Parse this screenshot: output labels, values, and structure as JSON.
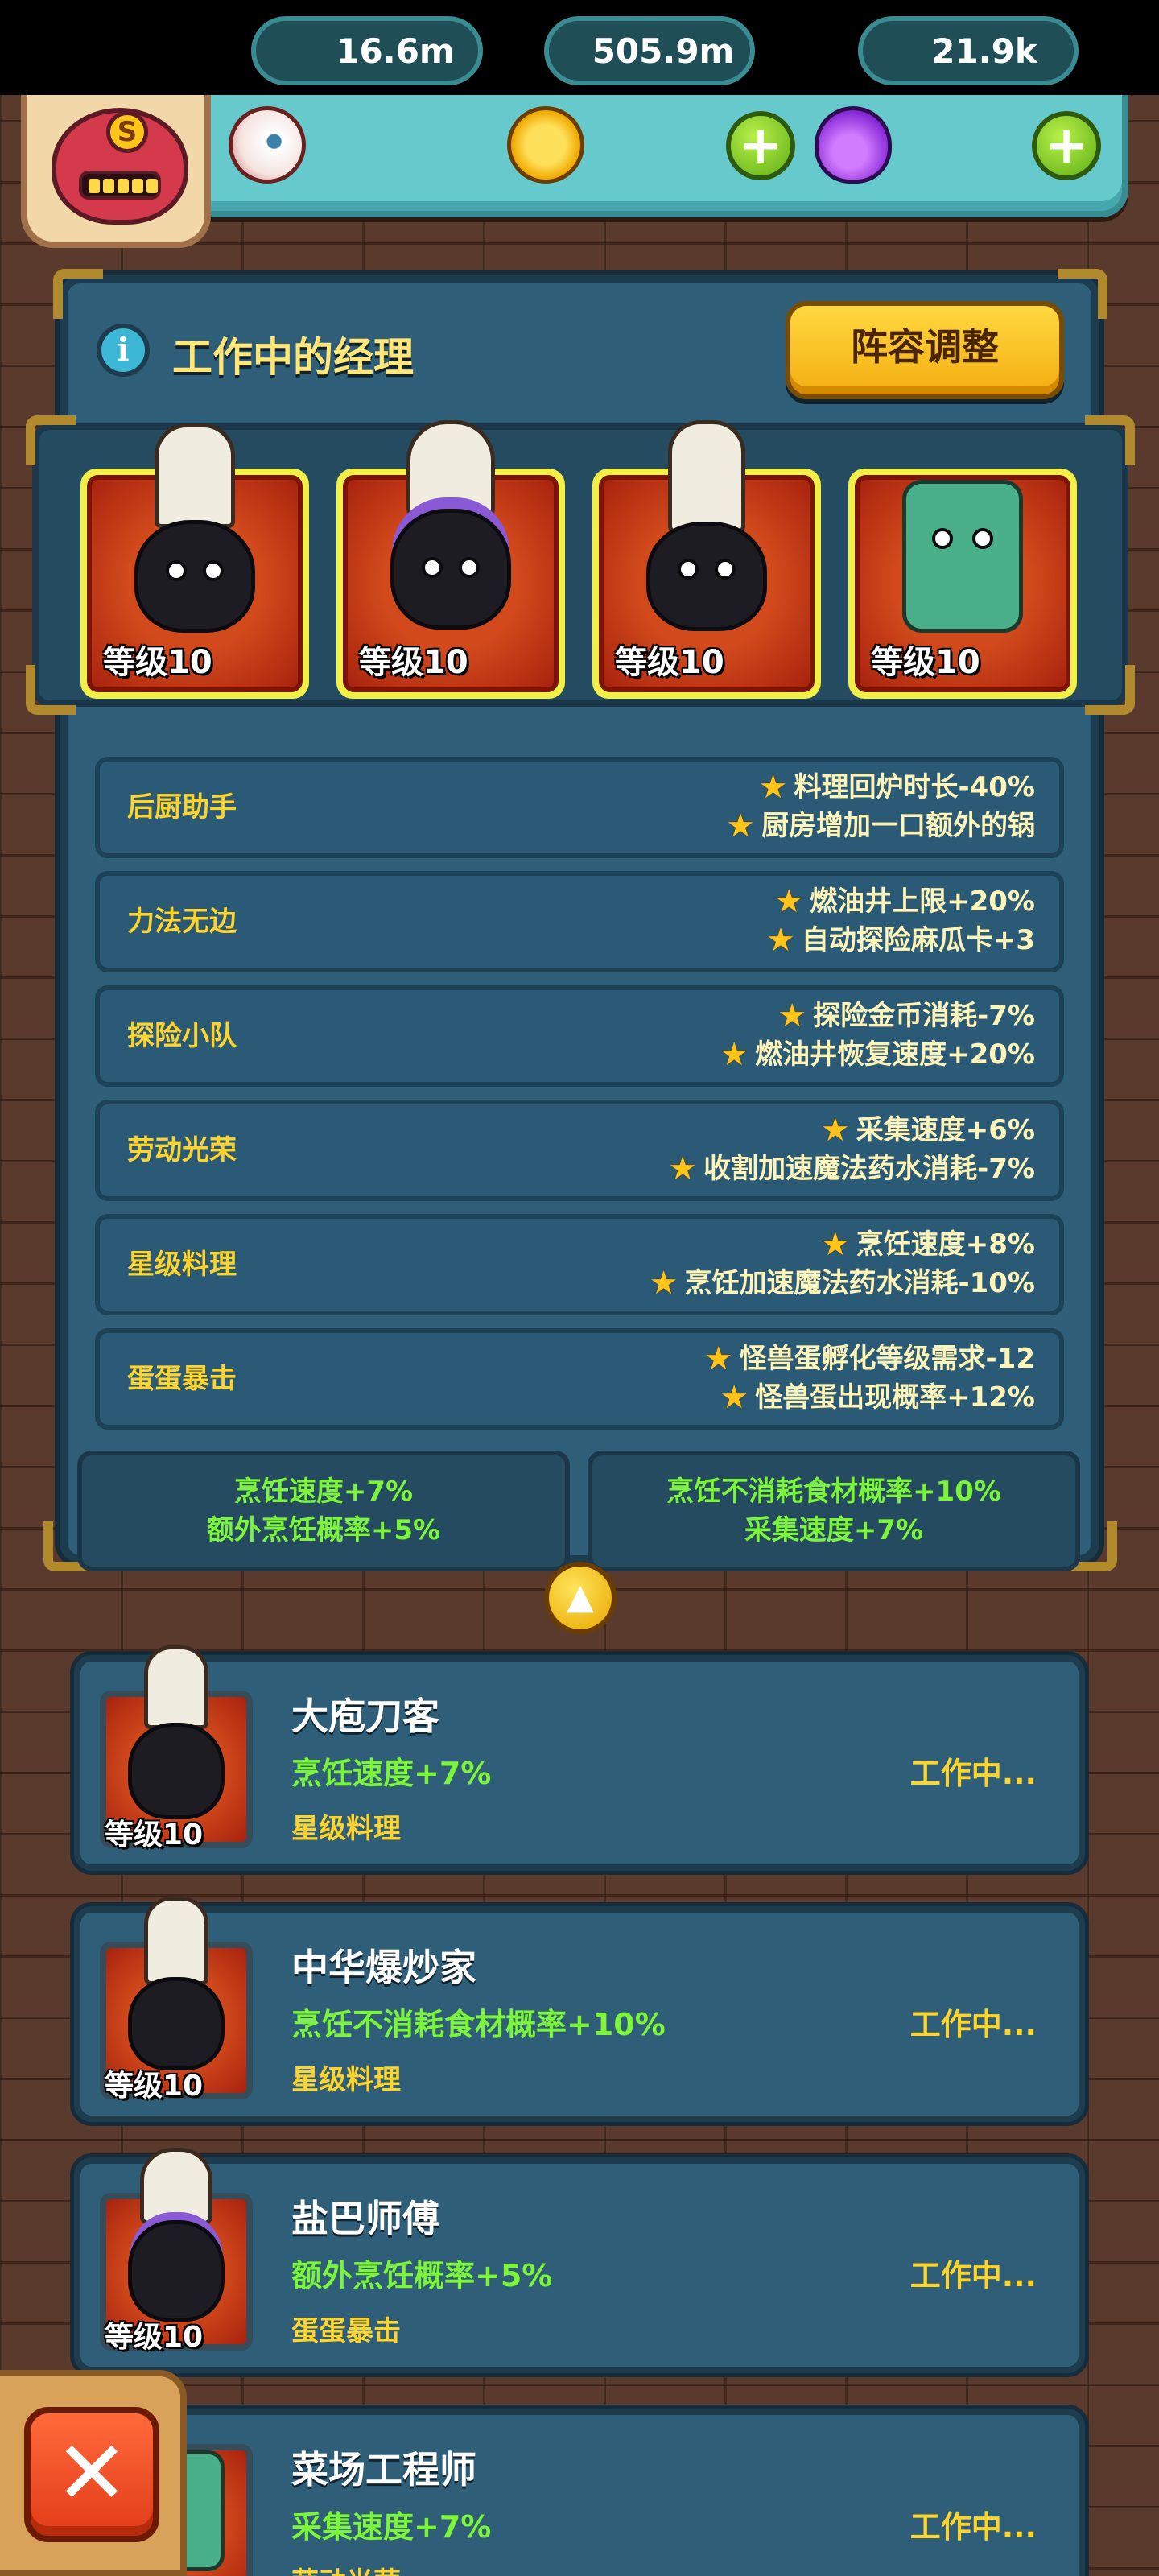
{
  "resources": {
    "eyeball": {
      "value": "16.6m",
      "icon": "eyeball-icon"
    },
    "coins": {
      "value": "505.9m",
      "icon": "coin-icon"
    },
    "potion": {
      "value": "21.9k",
      "icon": "potion-icon"
    },
    "avatar_badge": "S"
  },
  "panel": {
    "title": "工作中的经理",
    "adjust_button": "阵容调整",
    "collapse_icon": "chevron-up-icon"
  },
  "managers": [
    {
      "level": "等级10"
    },
    {
      "level": "等级10"
    },
    {
      "level": "等级10"
    },
    {
      "level": "等级10"
    }
  ],
  "skills": [
    {
      "name": "后厨助手",
      "effects": [
        "料理回炉时长-40%",
        "厨房增加一口额外的锅"
      ]
    },
    {
      "name": "力法无边",
      "effects": [
        "燃油井上限+20%",
        "自动探险麻瓜卡+3"
      ]
    },
    {
      "name": "探险小队",
      "effects": [
        "探险金币消耗-7%",
        "燃油井恢复速度+20%"
      ]
    },
    {
      "name": "劳动光荣",
      "effects": [
        "采集速度+6%",
        "收割加速魔法药水消耗-7%"
      ]
    },
    {
      "name": "星级料理",
      "effects": [
        "烹饪速度+8%",
        "烹饪加速魔法药水消耗-10%"
      ]
    },
    {
      "name": "蛋蛋暴击",
      "effects": [
        "怪兽蛋孵化等级需求-12",
        "怪兽蛋出现概率+12%"
      ]
    }
  ],
  "bonuses": [
    [
      "烹饪速度+7%",
      "额外烹饪概率+5%"
    ],
    [
      "烹饪不消耗食材概率+10%",
      "采集速度+7%"
    ]
  ],
  "manager_list": [
    {
      "name": "大庖刀客",
      "effect": "烹饪速度+7%",
      "skill": "星级料理",
      "status": "工作中...",
      "level": "等级10"
    },
    {
      "name": "中华爆炒家",
      "effect": "烹饪不消耗食材概率+10%",
      "skill": "星级料理",
      "status": "工作中...",
      "level": "等级10"
    },
    {
      "name": "盐巴师傅",
      "effect": "额外烹饪概率+5%",
      "skill": "蛋蛋暴击",
      "status": "工作中...",
      "level": "等级10"
    },
    {
      "name": "菜场工程师",
      "effect": "采集速度+7%",
      "skill": "劳动光荣",
      "status": "工作中...",
      "level": ""
    }
  ],
  "close_icon": "close-icon",
  "colors": {
    "panel_bg": "#2f5f78",
    "gold_text": "#ffd42a",
    "green_text": "#7cf43a",
    "button_yellow": "#f3ae10",
    "close_red": "#e23c18"
  }
}
